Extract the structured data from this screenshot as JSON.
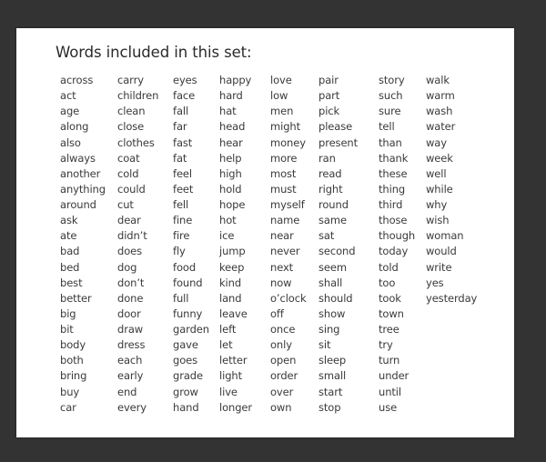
{
  "document": {
    "title": "Words included in this set:",
    "columns": [
      [
        "across",
        "act",
        "age",
        "along",
        "also",
        "always",
        "another",
        "anything",
        "around",
        "ask",
        "ate",
        "bad",
        "bed",
        "best",
        "better",
        "big",
        "bit",
        "body",
        "both",
        "bring",
        "buy",
        "car"
      ],
      [
        "carry",
        "children",
        "clean",
        "close",
        "clothes",
        "coat",
        "cold",
        "could",
        "cut",
        "dear",
        "didn’t",
        "does",
        "dog",
        "don’t",
        "done",
        "door",
        "draw",
        "dress",
        "each",
        "early",
        "end",
        "every"
      ],
      [
        "eyes",
        "face",
        "fall",
        "far",
        "fast",
        "fat",
        "feel",
        "feet",
        "fell",
        "fine",
        "fire",
        "fly",
        "food",
        "found",
        "full",
        "funny",
        "garden",
        "gave",
        "goes",
        "grade",
        "grow",
        "hand"
      ],
      [
        "happy",
        "hard",
        "hat",
        "head",
        "hear",
        "help",
        "high",
        "hold",
        "hope",
        "hot",
        "ice",
        "jump",
        "keep",
        "kind",
        "land",
        "leave",
        "left",
        "let",
        "letter",
        "light",
        "live",
        "longer"
      ],
      [
        "love",
        "low",
        "men",
        "might",
        "money",
        "more",
        "most",
        "must",
        "myself",
        "name",
        "near",
        "never",
        "next",
        "now",
        "o’clock",
        "off",
        "once",
        "only",
        "open",
        "order",
        "over",
        "own"
      ],
      [
        "pair",
        "part",
        "pick",
        "please",
        "present",
        "ran",
        "read",
        "right",
        "round",
        "same",
        "sat",
        "second",
        "seem",
        "shall",
        "should",
        "show",
        "sing",
        "sit",
        "sleep",
        "small",
        "start",
        "stop"
      ],
      [
        "story",
        "such",
        "sure",
        "tell",
        "than",
        "thank",
        "these",
        "thing",
        "third",
        "those",
        "though",
        "today",
        "told",
        "too",
        "took",
        "town",
        "tree",
        "try",
        "turn",
        "under",
        "until",
        "use"
      ],
      [
        "walk",
        "warm",
        "wash",
        "water",
        "way",
        "week",
        "well",
        "while",
        "why",
        "wish",
        "woman",
        "would",
        "write",
        "yes",
        "yesterday"
      ]
    ]
  }
}
